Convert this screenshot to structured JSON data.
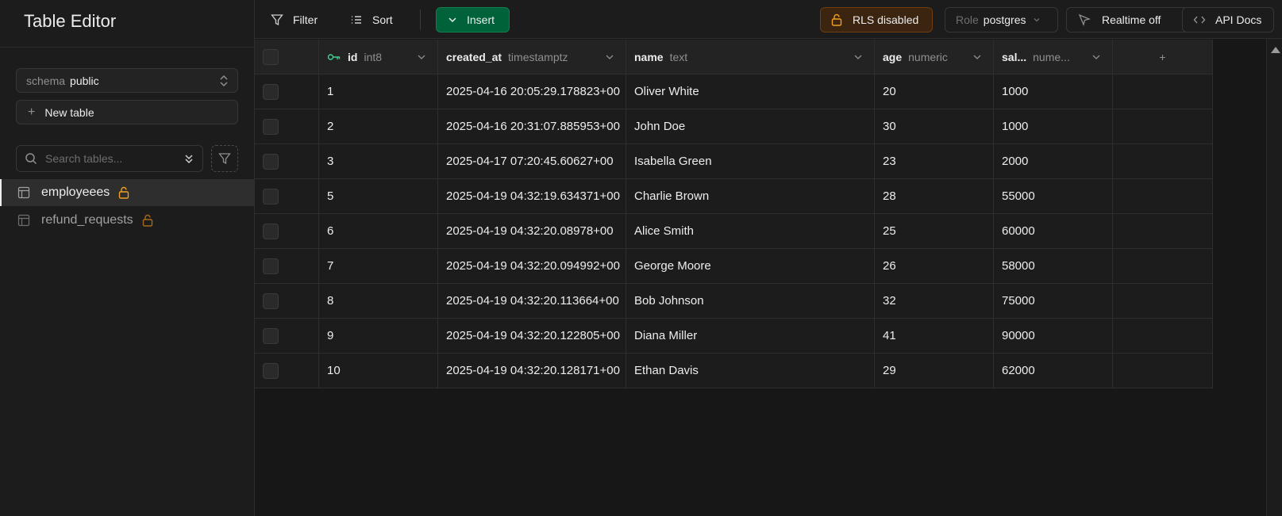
{
  "sidebar": {
    "title": "Table Editor",
    "schema": {
      "label": "schema",
      "value": "public"
    },
    "new_table_label": "New table",
    "search_placeholder": "Search tables...",
    "tables": [
      {
        "name": "employeees",
        "active": true
      },
      {
        "name": "refund_requests",
        "active": false
      }
    ]
  },
  "toolbar": {
    "filter_label": "Filter",
    "sort_label": "Sort",
    "insert_label": "Insert",
    "rls_label": "RLS disabled",
    "role_label": "Role",
    "role_value": "postgres",
    "realtime_label": "Realtime off",
    "api_docs_label": "API Docs"
  },
  "grid": {
    "columns": [
      {
        "name": "id",
        "type": "int8",
        "primary_key": true
      },
      {
        "name": "created_at",
        "type": "timestamptz"
      },
      {
        "name": "name",
        "type": "text"
      },
      {
        "name": "age",
        "type": "numeric"
      },
      {
        "name": "sal...",
        "type": "nume..."
      }
    ],
    "rows": [
      {
        "id": "1",
        "created_at": "2025-04-16 20:05:29.178823+00",
        "name": "Oliver White",
        "age": "20",
        "salary": "1000"
      },
      {
        "id": "2",
        "created_at": "2025-04-16 20:31:07.885953+00",
        "name": "John Doe",
        "age": "30",
        "salary": "1000"
      },
      {
        "id": "3",
        "created_at": "2025-04-17 07:20:45.60627+00",
        "name": "Isabella Green",
        "age": "23",
        "salary": "2000"
      },
      {
        "id": "5",
        "created_at": "2025-04-19 04:32:19.634371+00",
        "name": "Charlie Brown",
        "age": "28",
        "salary": "55000"
      },
      {
        "id": "6",
        "created_at": "2025-04-19 04:32:20.08978+00",
        "name": "Alice Smith",
        "age": "25",
        "salary": "60000"
      },
      {
        "id": "7",
        "created_at": "2025-04-19 04:32:20.094992+00",
        "name": "George Moore",
        "age": "26",
        "salary": "58000"
      },
      {
        "id": "8",
        "created_at": "2025-04-19 04:32:20.113664+00",
        "name": "Bob Johnson",
        "age": "32",
        "salary": "75000"
      },
      {
        "id": "9",
        "created_at": "2025-04-19 04:32:20.122805+00",
        "name": "Diana Miller",
        "age": "41",
        "salary": "90000"
      },
      {
        "id": "10",
        "created_at": "2025-04-19 04:32:20.128171+00",
        "name": "Ethan Davis",
        "age": "29",
        "salary": "62000"
      }
    ]
  },
  "colors": {
    "background": "#171717",
    "panel": "#1c1c1c",
    "insert_green": "#006239",
    "rls_amber": "#f0a020",
    "key_green": "#3ecf8e"
  },
  "icons": [
    "filter-icon",
    "sort-icon",
    "chevron-down-icon",
    "lock-icon",
    "eye-off-icon",
    "code-icon",
    "table-icon",
    "search-icon",
    "key-icon",
    "plus-icon"
  ]
}
